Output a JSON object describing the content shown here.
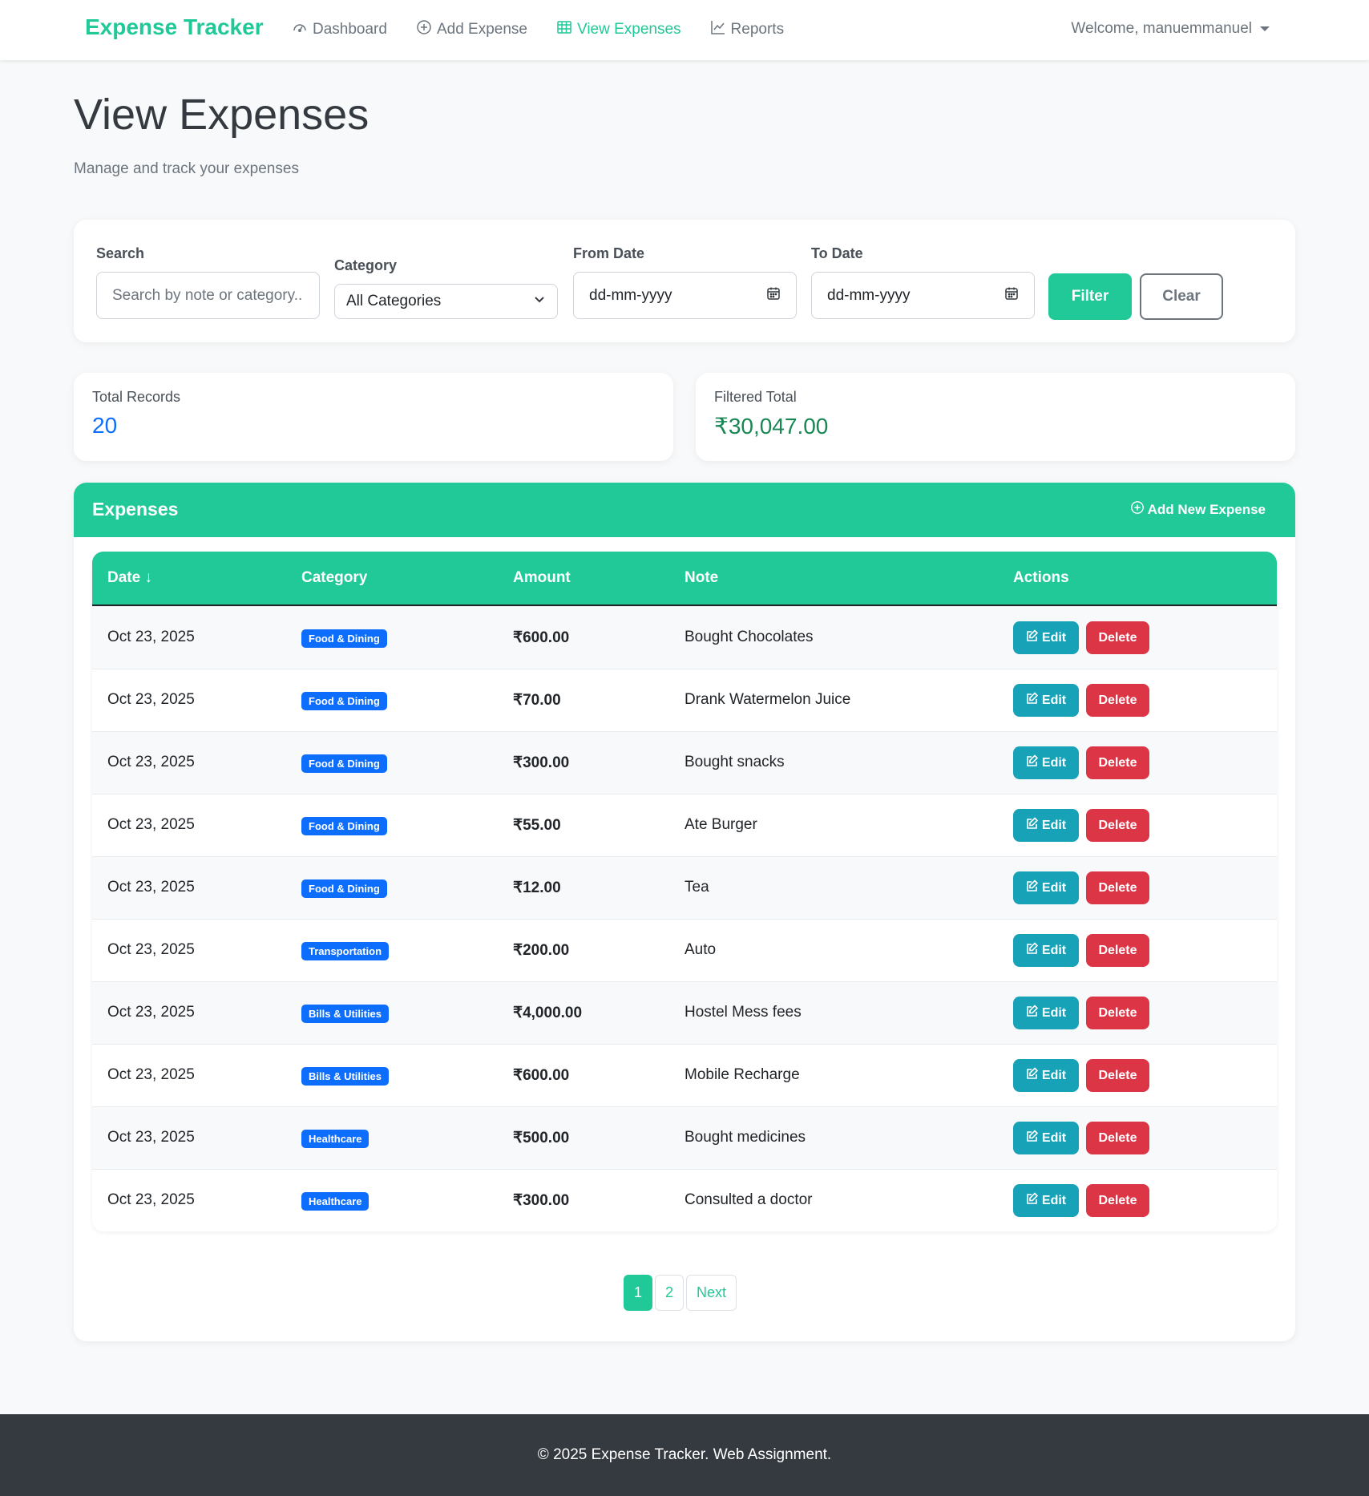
{
  "nav": {
    "brand": "Expense Tracker",
    "items": [
      {
        "label": "Dashboard",
        "icon": "gauge-icon",
        "active": false
      },
      {
        "label": "Add Expense",
        "icon": "plus-circle-icon",
        "active": false
      },
      {
        "label": "View Expenses",
        "icon": "table-icon",
        "active": true
      },
      {
        "label": "Reports",
        "icon": "chart-line-icon",
        "active": false
      }
    ],
    "user": "Welcome, manuemmanuel"
  },
  "header": {
    "title": "View Expenses",
    "subtitle": "Manage and track your expenses"
  },
  "filters": {
    "search_label": "Search",
    "search_placeholder": "Search by note or category...",
    "category_label": "Category",
    "category_value": "All Categories",
    "from_label": "From Date",
    "from_placeholder": "dd-mm-yyyy",
    "to_label": "To Date",
    "to_placeholder": "dd-mm-yyyy",
    "filter_button": "Filter",
    "clear_button": "Clear"
  },
  "stats": {
    "total_records_label": "Total Records",
    "total_records_value": "20",
    "filtered_total_label": "Filtered Total",
    "filtered_total_value": "₹30,047.00"
  },
  "expenses": {
    "title": "Expenses",
    "add_new": "Add New Expense",
    "columns": [
      "Date ↓",
      "Category",
      "Amount",
      "Note",
      "Actions"
    ],
    "edit_label": "Edit",
    "delete_label": "Delete",
    "rows": [
      {
        "date": "Oct 23, 2025",
        "category": "Food & Dining",
        "amount": "₹600.00",
        "note": "Bought Chocolates"
      },
      {
        "date": "Oct 23, 2025",
        "category": "Food & Dining",
        "amount": "₹70.00",
        "note": "Drank Watermelon Juice"
      },
      {
        "date": "Oct 23, 2025",
        "category": "Food & Dining",
        "amount": "₹300.00",
        "note": "Bought snacks"
      },
      {
        "date": "Oct 23, 2025",
        "category": "Food & Dining",
        "amount": "₹55.00",
        "note": "Ate Burger"
      },
      {
        "date": "Oct 23, 2025",
        "category": "Food & Dining",
        "amount": "₹12.00",
        "note": "Tea"
      },
      {
        "date": "Oct 23, 2025",
        "category": "Transportation",
        "amount": "₹200.00",
        "note": "Auto"
      },
      {
        "date": "Oct 23, 2025",
        "category": "Bills & Utilities",
        "amount": "₹4,000.00",
        "note": "Hostel Mess fees"
      },
      {
        "date": "Oct 23, 2025",
        "category": "Bills & Utilities",
        "amount": "₹600.00",
        "note": "Mobile Recharge"
      },
      {
        "date": "Oct 23, 2025",
        "category": "Healthcare",
        "amount": "₹500.00",
        "note": "Bought medicines"
      },
      {
        "date": "Oct 23, 2025",
        "category": "Healthcare",
        "amount": "₹300.00",
        "note": "Consulted a doctor"
      }
    ]
  },
  "pagination": {
    "pages": [
      "1",
      "2"
    ],
    "active": "1",
    "next": "Next"
  },
  "footer": {
    "text": "© 2025 Expense Tracker. Web Assignment."
  },
  "colors": {
    "accent": "#20c997",
    "badge": "#0d6efd",
    "edit": "#17a2b8",
    "delete": "#dc3545",
    "total_records": "#0d6efd",
    "filtered_total": "#198754",
    "footer_bg": "#343a40"
  }
}
